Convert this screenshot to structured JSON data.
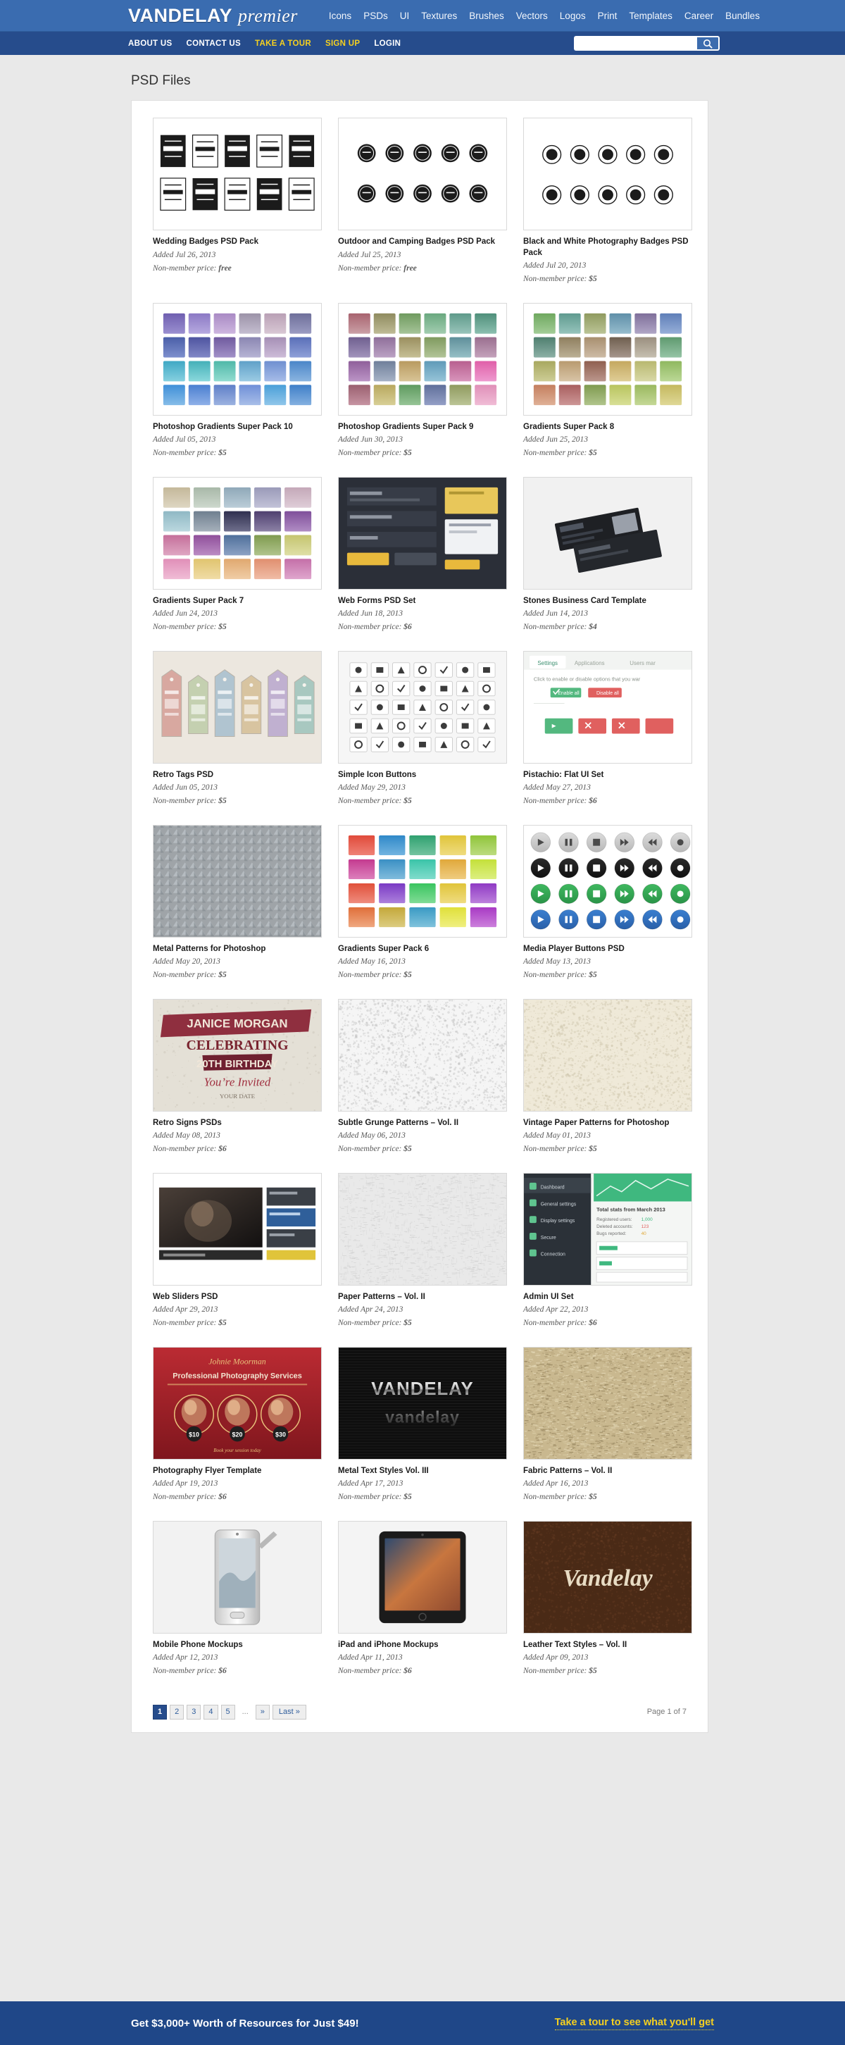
{
  "header": {
    "logo_bold": "VANDELAY",
    "logo_italic": "premier",
    "nav": [
      {
        "label": "Icons"
      },
      {
        "label": "PSDs"
      },
      {
        "label": "UI"
      },
      {
        "label": "Textures"
      },
      {
        "label": "Brushes"
      },
      {
        "label": "Vectors"
      },
      {
        "label": "Logos"
      },
      {
        "label": "Print"
      },
      {
        "label": "Templates"
      },
      {
        "label": "Career"
      },
      {
        "label": "Bundles"
      }
    ],
    "background_color": "#3a6cb0"
  },
  "subheader": {
    "nav": [
      {
        "label": "ABOUT US",
        "highlight": false
      },
      {
        "label": "CONTACT US",
        "highlight": false
      },
      {
        "label": "TAKE A TOUR",
        "highlight": true
      },
      {
        "label": "SIGN UP",
        "highlight": true
      },
      {
        "label": "LOGIN",
        "highlight": false
      }
    ],
    "search": {
      "value": "",
      "placeholder": ""
    },
    "background_color": "#264c8c",
    "highlight_color": "#f5d020"
  },
  "main": {
    "page_title": "PSD Files",
    "rows": [
      [
        {
          "title": "Wedding Badges PSD Pack",
          "added": "Added Jul 26, 2013",
          "price_label": "Non-member price:",
          "price": "free",
          "thumb": "wedding-badges"
        },
        {
          "title": "Outdoor and Camping Badges PSD Pack",
          "added": "Added Jul 25, 2013",
          "price_label": "Non-member price:",
          "price": "free",
          "thumb": "outdoor-badges"
        },
        {
          "title": "Black and White Photography Badges PSD Pack",
          "added": "Added Jul 20, 2013",
          "price_label": "Non-member price:",
          "price": "$5",
          "thumb": "bw-badges"
        }
      ],
      [
        {
          "title": "Photoshop Gradients Super Pack 10",
          "added": "Added Jul 05, 2013",
          "price_label": "Non-member price:",
          "price": "$5",
          "thumb": "gradients-10"
        },
        {
          "title": "Photoshop Gradients Super Pack 9",
          "added": "Added Jun 30, 2013",
          "price_label": "Non-member price:",
          "price": "$5",
          "thumb": "gradients-9"
        },
        {
          "title": "Gradients Super Pack 8",
          "added": "Added Jun 25, 2013",
          "price_label": "Non-member price:",
          "price": "$5",
          "thumb": "gradients-8"
        }
      ],
      [
        {
          "title": "Gradients Super Pack 7",
          "added": "Added Jun 24, 2013",
          "price_label": "Non-member price:",
          "price": "$5",
          "thumb": "gradients-7"
        },
        {
          "title": "Web Forms PSD Set",
          "added": "Added Jun 18, 2013",
          "price_label": "Non-member price:",
          "price": "$6",
          "thumb": "web-forms"
        },
        {
          "title": "Stones Business Card Template",
          "added": "Added Jun 14, 2013",
          "price_label": "Non-member price:",
          "price": "$4",
          "thumb": "stones-card"
        }
      ],
      [
        {
          "title": "Retro Tags PSD",
          "added": "Added Jun 05, 2013",
          "price_label": "Non-member price:",
          "price": "$5",
          "thumb": "retro-tags"
        },
        {
          "title": "Simple Icon Buttons",
          "added": "Added May 29, 2013",
          "price_label": "Non-member price:",
          "price": "$5",
          "thumb": "simple-icons"
        },
        {
          "title": "Pistachio: Flat UI Set",
          "added": "Added May 27, 2013",
          "price_label": "Non-member price:",
          "price": "$6",
          "thumb": "pistachio-ui"
        }
      ],
      [
        {
          "title": "Metal Patterns for Photoshop",
          "added": "Added May 20, 2013",
          "price_label": "Non-member price:",
          "price": "$5",
          "thumb": "metal-patterns"
        },
        {
          "title": "Gradients Super Pack 6",
          "added": "Added May 16, 2013",
          "price_label": "Non-member price:",
          "price": "$5",
          "thumb": "gradients-6"
        },
        {
          "title": "Media Player Buttons PSD",
          "added": "Added May 13, 2013",
          "price_label": "Non-member price:",
          "price": "$5",
          "thumb": "media-buttons"
        }
      ],
      [
        {
          "title": "Retro Signs PSDs",
          "added": "Added May 08, 2013",
          "price_label": "Non-member price:",
          "price": "$6",
          "thumb": "retro-signs"
        },
        {
          "title": "Subtle Grunge Patterns – Vol. II",
          "added": "Added May 06, 2013",
          "price_label": "Non-member price:",
          "price": "$5",
          "thumb": "grunge-patterns"
        },
        {
          "title": "Vintage Paper Patterns for Photoshop",
          "added": "Added May 01, 2013",
          "price_label": "Non-member price:",
          "price": "$5",
          "thumb": "vintage-paper"
        }
      ],
      [
        {
          "title": "Web Sliders PSD",
          "added": "Added Apr 29, 2013",
          "price_label": "Non-member price:",
          "price": "$5",
          "thumb": "web-sliders"
        },
        {
          "title": "Paper Patterns – Vol. II",
          "added": "Added Apr 24, 2013",
          "price_label": "Non-member price:",
          "price": "$5",
          "thumb": "paper-patterns"
        },
        {
          "title": "Admin UI Set",
          "added": "Added Apr 22, 2013",
          "price_label": "Non-member price:",
          "price": "$6",
          "thumb": "admin-ui"
        }
      ],
      [
        {
          "title": "Photography Flyer Template",
          "added": "Added Apr 19, 2013",
          "price_label": "Non-member price:",
          "price": "$6",
          "thumb": "photo-flyer"
        },
        {
          "title": "Metal Text Styles Vol. III",
          "added": "Added Apr 17, 2013",
          "price_label": "Non-member price:",
          "price": "$5",
          "thumb": "metal-text"
        },
        {
          "title": "Fabric Patterns – Vol. II",
          "added": "Added Apr 16, 2013",
          "price_label": "Non-member price:",
          "price": "$5",
          "thumb": "fabric-patterns"
        }
      ],
      [
        {
          "title": "Mobile Phone Mockups",
          "added": "Added Apr 12, 2013",
          "price_label": "Non-member price:",
          "price": "$6",
          "thumb": "phone-mockups"
        },
        {
          "title": "iPad and iPhone Mockups",
          "added": "Added Apr 11, 2013",
          "price_label": "Non-member price:",
          "price": "$6",
          "thumb": "ipad-mockups"
        },
        {
          "title": "Leather Text Styles – Vol. II",
          "added": "Added Apr 09, 2013",
          "price_label": "Non-member price:",
          "price": "$5",
          "thumb": "leather-text"
        }
      ]
    ],
    "pagination": {
      "pages": [
        "1",
        "2",
        "3",
        "4",
        "5"
      ],
      "ellipsis": "...",
      "next": "»",
      "last": "Last »",
      "active": "1",
      "info": "Page 1 of 7"
    }
  },
  "footer": {
    "headline": "Get $3,000+ Worth of Resources for Just $49!",
    "cta": "Take a tour to see what you'll get",
    "background_color": "#1f4788",
    "cta_color": "#f5d020"
  }
}
